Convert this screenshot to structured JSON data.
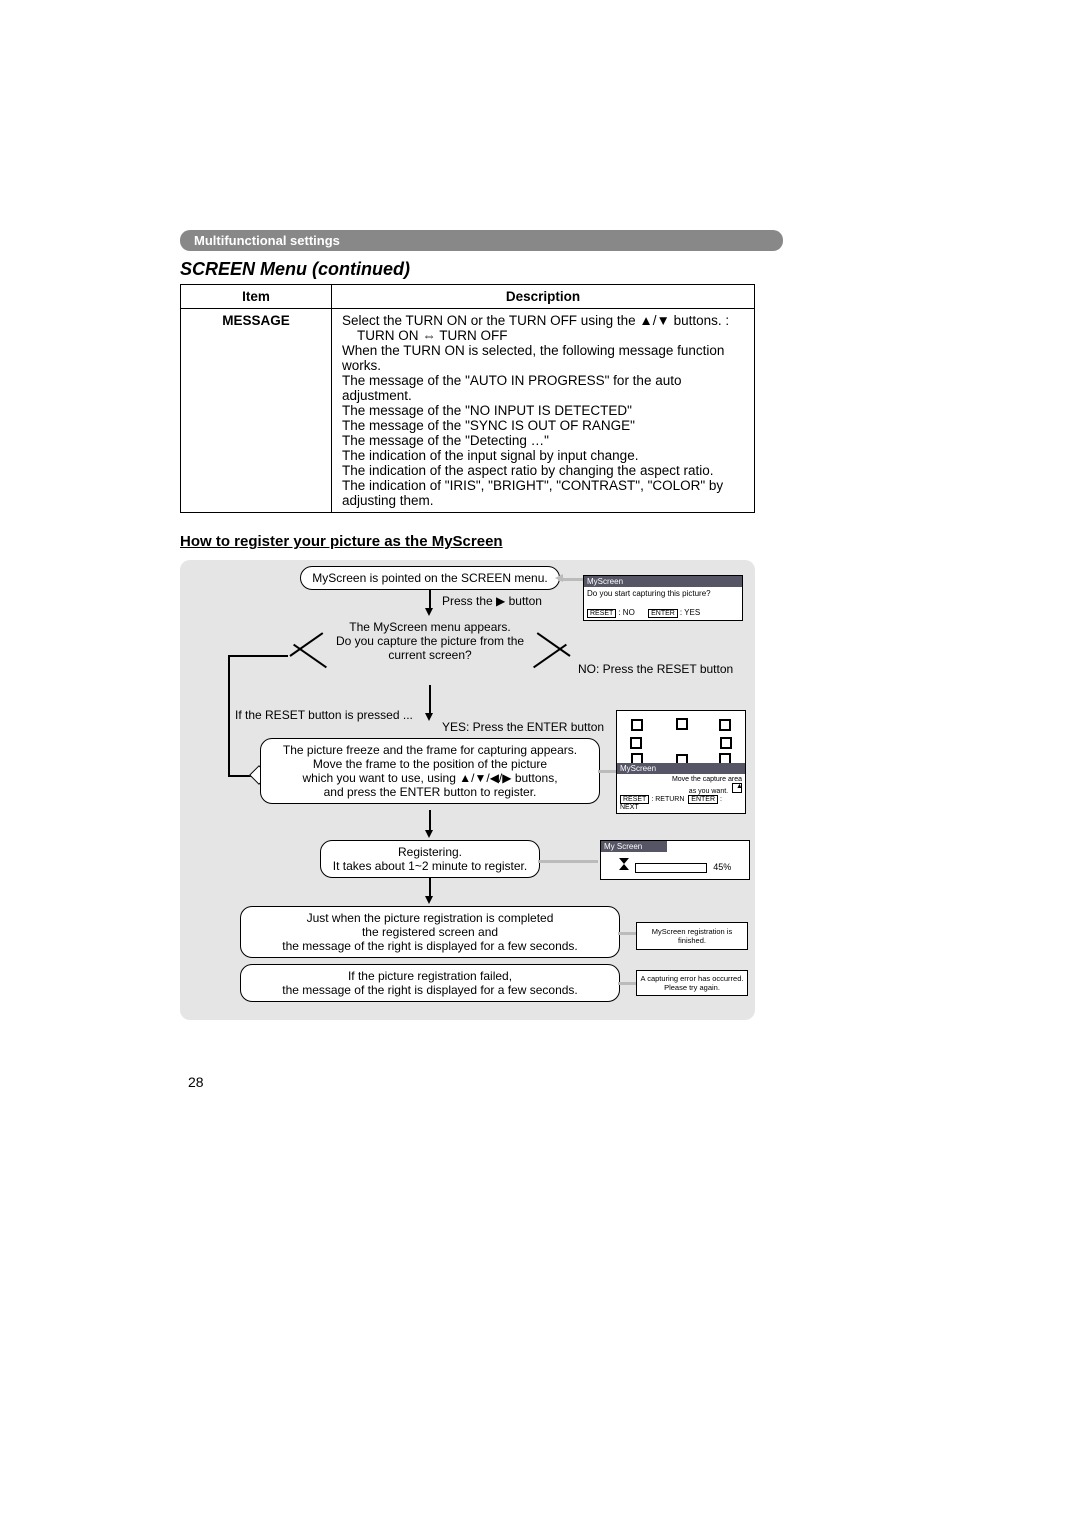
{
  "breadcrumb": "Multifunctional settings",
  "title": "SCREEN Menu (continued)",
  "table": {
    "head_item": "Item",
    "head_desc": "Description",
    "row_item": "MESSAGE",
    "desc_line1a": "Select the TURN ON or the TURN OFF using the ",
    "desc_line1b": " buttons. :",
    "desc_line2a": "TURN ON ",
    "desc_line2b": " TURN OFF",
    "desc_line3": "When the TURN ON is selected, the following message function works.",
    "desc_line4": "The message of the \"AUTO IN PROGRESS\" for the auto adjustment.",
    "desc_line5": "The message of the \"NO INPUT IS DETECTED\"",
    "desc_line6": "The message of the \"SYNC IS OUT OF RANGE\"",
    "desc_line7": "The message of the \"Detecting …\"",
    "desc_line8": "The indication of the input signal by input change.",
    "desc_line9": "The indication of the aspect ratio by changing the aspect ratio.",
    "desc_line10": "The indication of \"IRIS\", \"BRIGHT\", \"CONTRAST\", \"COLOR\" by adjusting them."
  },
  "subheading": "How to register your picture as the MyScreen",
  "flow": {
    "step1": "MyScreen is pointed on the SCREEN menu.",
    "press_right_a": "Press the ",
    "press_right_b": " button",
    "decision_a": "The MyScreen menu appears.",
    "decision_b": "Do you capture the picture from the current screen?",
    "no_branch": "NO: Press the RESET button",
    "if_reset": "If the RESET button is pressed ...",
    "yes_branch": "YES: Press the ENTER button",
    "step3_l1": "The picture freeze and the frame for capturing appears.",
    "step3_l2": "Move the frame to the position of the picture",
    "step3_l3a": "which you want to use, using ",
    "step3_l3b": " buttons,",
    "step3_l4": "and press the ENTER button to register.",
    "step4_l1": "Registering.",
    "step4_l2": "It takes about 1~2 minute to register.",
    "step5_l1": "Just when the picture registration is completed",
    "step5_l2": "the registered screen and",
    "step5_l3": "the message of the right is displayed for a few seconds.",
    "step6_l1": "If the picture registration failed,",
    "step6_l2": "the message of the right is displayed for a few seconds."
  },
  "mini1": {
    "title": "MyScreen",
    "q": "Do you start capturing this picture?",
    "reset": "RESET",
    "no": ": NO",
    "enter": "ENTER",
    "yes": ": YES"
  },
  "mini2": {
    "title": "MyScreen",
    "l1": "Move the capture area",
    "l2": "as you want.",
    "reset": "RESET",
    "ret": ": RETURN",
    "enter": "ENTER",
    "next": ": NEXT"
  },
  "mini3": {
    "title": "My Screen",
    "percent": "45%"
  },
  "mini4": {
    "msg": "MyScreen registration is finished."
  },
  "mini5": {
    "l1": "A capturing error has occurred.",
    "l2": "Please try again."
  },
  "page_number": "28",
  "glyph": {
    "up": "▲",
    "down": "▼",
    "left": "◀",
    "right": "▶",
    "lr": "⇔"
  }
}
